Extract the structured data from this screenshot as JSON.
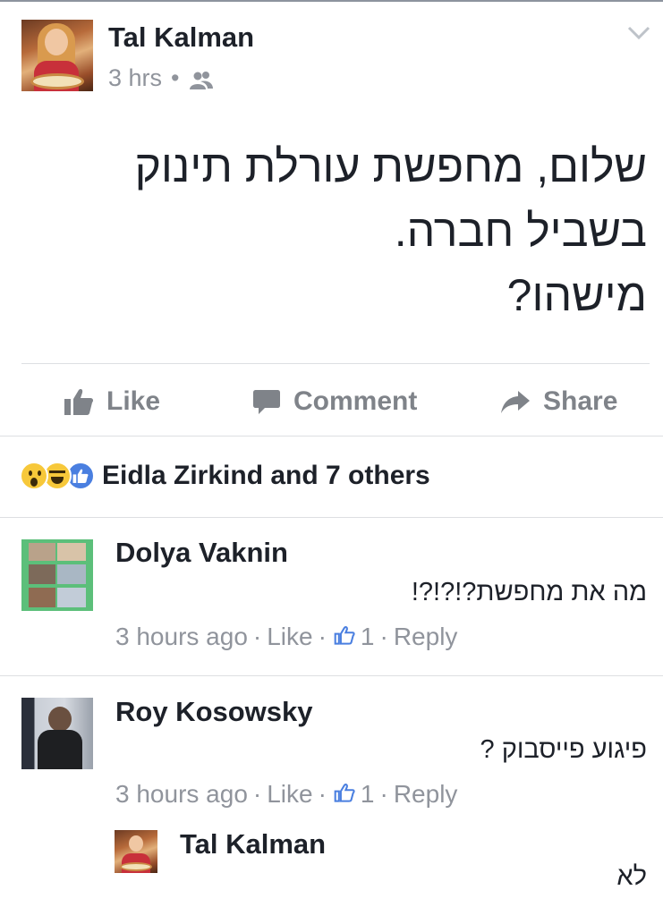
{
  "post": {
    "author": "Tal Kalman",
    "time": "3 hrs",
    "meta_dot": "•",
    "audience_icon": "friends-icon",
    "menu_icon": "chevron-down-icon",
    "text_lines": [
      "שלום, מחפשת עורלת תינוק",
      "בשביל חברה.",
      "מישהו?"
    ]
  },
  "actions": {
    "like": "Like",
    "comment": "Comment",
    "share": "Share"
  },
  "reactions": {
    "icons": [
      "wow-icon",
      "haha-icon",
      "like-icon"
    ],
    "summary": "Eidla Zirkind and 7 others"
  },
  "comments": [
    {
      "name": "Dolya Vaknin",
      "text": "מה את מחפשת?!?!?!",
      "time": "3 hours ago",
      "like_label": "Like",
      "like_count": "1",
      "reply_label": "Reply"
    },
    {
      "name": "Roy Kosowsky",
      "text": "פיגוע פייסבוק ?",
      "time": "3 hours ago",
      "like_label": "Like",
      "like_count": "1",
      "reply_label": "Reply"
    }
  ],
  "reply": {
    "name": "Tal Kalman",
    "text": "לא"
  },
  "colors": {
    "text": "#1d2129",
    "meta": "#90949c",
    "action": "#7f8389",
    "like_blue": "#4a7fe0",
    "divider": "#dddfe2"
  },
  "separator": "·"
}
